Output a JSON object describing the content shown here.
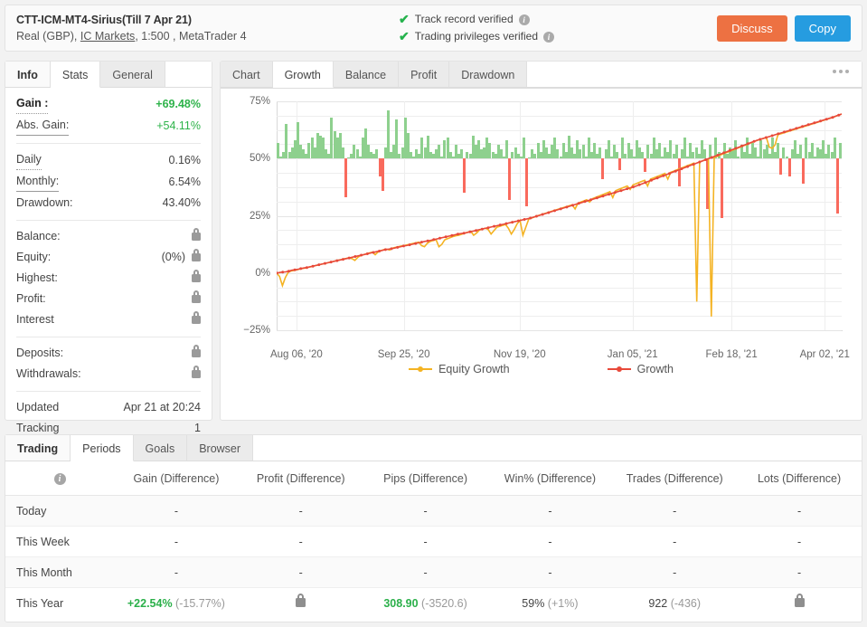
{
  "header": {
    "account_title": "CTT-ICM-MT4-Sirius(Till 7 Apr 21)",
    "account_type": "Real (GBP),",
    "broker": "IC Markets",
    "leverage_platform": ", 1:500 , MetaTrader 4",
    "verified_track": "Track record verified",
    "verified_privileges": "Trading privileges verified",
    "discuss_label": "Discuss",
    "copy_label": "Copy",
    "discuss_color": "#ed7142",
    "copy_color": "#269ce0"
  },
  "left_panel": {
    "tabs": [
      {
        "label": "Info",
        "active": false
      },
      {
        "label": "Stats",
        "active": true
      },
      {
        "label": "General",
        "active": false
      }
    ],
    "stats": [
      {
        "label": "Gain :",
        "value": "+69.48%",
        "style": "green-bold"
      },
      {
        "label": "Abs. Gain:",
        "value": "+54.11%",
        "style": "green"
      },
      {
        "label": "Daily",
        "value": "0.16%",
        "style": "plain"
      },
      {
        "label": "Monthly:",
        "value": "6.54%",
        "style": "plain"
      },
      {
        "label": "Drawdown:",
        "value": "43.40%",
        "style": "plain"
      },
      {
        "label": "Balance:",
        "value": "",
        "style": "lock"
      },
      {
        "label": "Equity:",
        "value": "(0%)",
        "style": "lock"
      },
      {
        "label": "Highest:",
        "value": "",
        "style": "lock"
      },
      {
        "label": "Profit:",
        "value": "",
        "style": "lock"
      },
      {
        "label": "Interest",
        "value": "",
        "style": "lock"
      },
      {
        "label": "Deposits:",
        "value": "",
        "style": "lock"
      },
      {
        "label": "Withdrawals:",
        "value": "",
        "style": "lock"
      },
      {
        "label": "Updated",
        "value": "Apr 21 at 20:24",
        "style": "plain"
      },
      {
        "label": "Tracking",
        "value": "1",
        "style": "plain"
      }
    ]
  },
  "chart_panel": {
    "tabs": [
      {
        "label": "Chart",
        "active": false
      },
      {
        "label": "Growth",
        "active": true
      },
      {
        "label": "Balance",
        "active": false
      },
      {
        "label": "Profit",
        "active": false
      },
      {
        "label": "Drawdown",
        "active": false
      }
    ],
    "menu_icon": "more-options-icon"
  },
  "chart_data": {
    "type": "line",
    "title": "",
    "xlabel": "",
    "ylabel": "",
    "ylim": [
      -25,
      75
    ],
    "yticks": [
      -25,
      0,
      25,
      50,
      75
    ],
    "ytick_labels": [
      "−25%",
      "0%",
      "25%",
      "50%",
      "75%"
    ],
    "xtick_labels": [
      "Aug 06, '20",
      "Sep 25, '20",
      "Nov 19, '20",
      "Jan 05, '21",
      "Feb 18, '21",
      "Apr 02, '21"
    ],
    "xtick_positions_pct": [
      3.5,
      22.5,
      43.0,
      63.0,
      80.5,
      97.0
    ],
    "grid": true,
    "legend_position": "bottom",
    "legend": [
      {
        "name": "Equity Growth",
        "color": "#f4b323"
      },
      {
        "name": "Growth",
        "color": "#e8493a"
      }
    ],
    "series": [
      {
        "name": "Growth",
        "color": "#e8493a",
        "marker": true,
        "values": [
          0,
          0.2,
          0.4,
          0.5,
          0.8,
          1.2,
          1.4,
          1.6,
          1.9,
          2.2,
          2.4,
          2.7,
          3.0,
          3.3,
          3.6,
          3.9,
          4.2,
          4.5,
          4.8,
          5.1,
          5.4,
          5.7,
          6.0,
          6.3,
          6.6,
          6.9,
          7.2,
          7.5,
          7.8,
          8.1,
          8.4,
          8.7,
          9.0,
          9.3,
          9.6,
          9.9,
          10.2,
          10.4,
          10.6,
          10.9,
          11.2,
          11.5,
          11.8,
          12.0,
          12.3,
          12.6,
          12.9,
          13.2,
          13.5,
          13.8,
          14.0,
          14.3,
          14.6,
          14.9,
          15.2,
          15.5,
          15.8,
          16.1,
          16.4,
          16.7,
          17.0,
          17.2,
          17.4,
          17.7,
          18.0,
          18.3,
          18.6,
          18.9,
          19.2,
          19.5,
          19.8,
          20.1,
          20.4,
          20.7,
          21.0,
          21.3,
          21.6,
          21.9,
          22.2,
          22.5,
          22.8,
          23.1,
          23.4,
          23.7,
          24.0,
          24.4,
          24.8,
          25.2,
          25.6,
          26.0,
          26.4,
          26.8,
          27.2,
          27.6,
          28.0,
          28.4,
          28.8,
          29.2,
          29.6,
          30.0,
          30.4,
          30.8,
          31.2,
          31.6,
          32.0,
          32.4,
          32.8,
          33.2,
          33.6,
          34.0,
          34.4,
          34.8,
          35.2,
          35.6,
          36.0,
          36.4,
          36.8,
          37.2,
          37.6,
          38.0,
          38.5,
          39.0,
          39.5,
          40.0,
          40.5,
          41.0,
          41.5,
          42.0,
          42.5,
          43.0,
          43.5,
          44.0,
          44.5,
          45.0,
          45.5,
          46.0,
          46.5,
          47.0,
          47.5,
          48.0,
          48.5,
          49.0,
          49.5,
          50.0,
          50.5,
          51.0,
          51.5,
          52.0,
          52.5,
          53.0,
          53.5,
          54.0,
          54.5,
          55.0,
          55.5,
          56.0,
          56.5,
          57.0,
          57.5,
          58.0,
          58.4,
          58.8,
          59.2,
          59.6,
          60.0,
          60.4,
          60.8,
          61.2,
          61.6,
          62.0,
          62.4,
          62.8,
          63.2,
          63.6,
          64.0,
          64.4,
          64.8,
          65.2,
          65.6,
          66.0,
          66.4,
          66.8,
          67.2,
          67.6,
          68.0,
          68.5,
          69.0,
          69.48
        ]
      },
      {
        "name": "Equity Growth",
        "color": "#f4b323",
        "marker": false,
        "values": [
          0,
          -1.5,
          -5.5,
          -2.0,
          0.3,
          0.9,
          1.1,
          1.4,
          1.7,
          2.0,
          2.2,
          2.5,
          2.8,
          3.1,
          3.4,
          3.7,
          4.0,
          4.3,
          4.6,
          4.9,
          5.2,
          5.5,
          5.8,
          6.1,
          6.4,
          6.7,
          6.3,
          5.5,
          6.8,
          7.6,
          8.0,
          8.4,
          8.8,
          9.1,
          8.0,
          9.2,
          9.8,
          10.2,
          10.4,
          10.0,
          10.9,
          11.2,
          11.5,
          11.8,
          12.0,
          12.3,
          12.6,
          12.9,
          13.2,
          13.5,
          12.0,
          11.5,
          13.0,
          13.8,
          14.2,
          14.6,
          11.5,
          12.5,
          14.5,
          15.0,
          15.5,
          16.0,
          16.3,
          16.6,
          17.0,
          17.4,
          17.8,
          18.2,
          16.5,
          17.5,
          18.8,
          19.2,
          19.6,
          19.0,
          17.0,
          18.5,
          20.0,
          20.4,
          20.8,
          21.2,
          19.5,
          17.0,
          19.0,
          21.5,
          23.0,
          16.5,
          20.0,
          23.5,
          24.0,
          24.5,
          25.0,
          25.4,
          25.8,
          26.2,
          26.6,
          27.0,
          27.4,
          27.8,
          28.2,
          28.6,
          29.0,
          29.4,
          29.8,
          28.0,
          30.5,
          31.0,
          31.5,
          32.0,
          31.0,
          32.5,
          33.0,
          33.5,
          34.0,
          34.5,
          35.0,
          35.5,
          33.0,
          36.0,
          36.5,
          37.0,
          37.5,
          38.0,
          36.5,
          38.5,
          39.0,
          39.5,
          40.0,
          40.5,
          38.0,
          41.0,
          41.5,
          42.0,
          42.5,
          43.0,
          43.5,
          41.0,
          44.0,
          44.5,
          45.0,
          45.5,
          46.0,
          46.5,
          47.0,
          47.5,
          48.0,
          -12.5,
          48.5,
          49.0,
          49.5,
          50.0,
          -19.0,
          50.5,
          51.0,
          51.5,
          52.0,
          52.5,
          53.0,
          53.5,
          54.0,
          54.5,
          55.0,
          55.5,
          56.0,
          56.5,
          57.0,
          57.5,
          58.0,
          58.4,
          58.8,
          59.2,
          55.0,
          54.5,
          56.0,
          60.4,
          60.8,
          61.2,
          61.6,
          62.0,
          62.4,
          62.8,
          63.2,
          63.6,
          64.0,
          64.4,
          64.8,
          65.2,
          65.6,
          66.0,
          66.4,
          66.8,
          67.2,
          67.6,
          68.0,
          68.5,
          69.0,
          69.48
        ]
      }
    ],
    "bars_note": "Daily profit/loss bars drawn from a 50% baseline; green upward = profit day, red downward = loss day.",
    "bar_baseline_pct": 50,
    "bars": [
      7,
      1,
      3,
      15,
      3,
      5,
      8,
      16,
      6,
      4,
      2,
      7,
      9,
      5,
      11,
      10,
      9,
      4,
      2,
      18,
      12,
      9,
      11,
      5,
      -17,
      0.5,
      2,
      6,
      4,
      1,
      9,
      13,
      6,
      3,
      2,
      4,
      -8,
      -14,
      5,
      21,
      3,
      6,
      17,
      2,
      5,
      18,
      11,
      3,
      1,
      4,
      2,
      9,
      5,
      10,
      3,
      2,
      4,
      6,
      1,
      8,
      9,
      3,
      1,
      6,
      2,
      4,
      -15,
      3,
      2,
      10,
      6,
      8,
      4,
      5,
      9,
      7,
      3,
      2,
      6,
      4,
      1,
      8,
      -18,
      3,
      5,
      2,
      1,
      9,
      -21,
      0.5,
      4,
      2,
      7,
      3,
      8,
      5,
      2,
      6,
      9,
      4,
      1,
      7,
      3,
      10,
      5,
      2,
      8,
      4,
      6,
      1,
      9,
      3,
      7,
      2,
      5,
      -9,
      4,
      8,
      1,
      6,
      3,
      -5,
      9,
      2,
      7,
      4,
      1,
      8,
      5,
      3,
      -6,
      6,
      2,
      9,
      4,
      7,
      1,
      5,
      3,
      8,
      2,
      6,
      -12,
      4,
      9,
      1,
      7,
      3,
      5,
      2,
      8,
      4,
      -22,
      6,
      1,
      9,
      3,
      -26,
      7,
      2,
      5,
      4,
      8,
      1,
      6,
      3,
      9,
      2,
      7,
      5,
      1,
      8,
      4,
      6,
      2,
      9,
      3,
      7,
      -7,
      5,
      1,
      -8,
      4,
      8,
      2,
      6,
      -11,
      9,
      3,
      7,
      1,
      5,
      4,
      8,
      2,
      6,
      3,
      9,
      -24,
      7
    ]
  },
  "table_panel": {
    "tabs": [
      {
        "label": "Trading",
        "active": false
      },
      {
        "label": "Periods",
        "active": true
      },
      {
        "label": "Goals",
        "active": false
      },
      {
        "label": "Browser",
        "active": false
      }
    ],
    "columns": [
      "",
      "Gain (Difference)",
      "Profit (Difference)",
      "Pips (Difference)",
      "Win% (Difference)",
      "Trades (Difference)",
      "Lots (Difference)"
    ],
    "header_info_icon": "info-icon",
    "rows": [
      {
        "period": "Today",
        "gain": "-",
        "gain_diff": "",
        "profit": "-",
        "profit_locked": false,
        "pips": "-",
        "pips_diff": "",
        "win": "-",
        "win_diff": "",
        "trades": "-",
        "trades_diff": "",
        "lots": "-",
        "lots_locked": false
      },
      {
        "period": "This Week",
        "gain": "-",
        "gain_diff": "",
        "profit": "-",
        "profit_locked": false,
        "pips": "-",
        "pips_diff": "",
        "win": "-",
        "win_diff": "",
        "trades": "-",
        "trades_diff": "",
        "lots": "-",
        "lots_locked": false
      },
      {
        "period": "This Month",
        "gain": "-",
        "gain_diff": "",
        "profit": "-",
        "profit_locked": false,
        "pips": "-",
        "pips_diff": "",
        "win": "-",
        "win_diff": "",
        "trades": "-",
        "trades_diff": "",
        "lots": "-",
        "lots_locked": false
      },
      {
        "period": "This Year",
        "gain": "+22.54%",
        "gain_diff": "(-15.77%)",
        "profit": "",
        "profit_locked": true,
        "pips": "308.90",
        "pips_diff": "(-3520.6)",
        "win": "59%",
        "win_diff": "(+1%)",
        "trades": "922",
        "trades_diff": "(-436)",
        "lots": "",
        "lots_locked": true
      }
    ]
  }
}
